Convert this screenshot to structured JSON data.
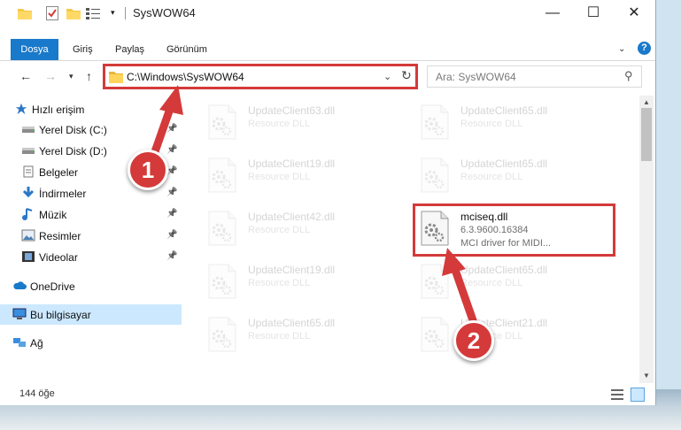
{
  "window": {
    "title": "SysWOW64",
    "controls": {
      "minimize": "—",
      "maximize": "☐",
      "close": "✕"
    }
  },
  "ribbon": {
    "tabs": [
      "Dosya",
      "Giriş",
      "Paylaş",
      "Görünüm"
    ],
    "help": "?"
  },
  "navbar": {
    "address": "C:\\Windows\\SysWOW64",
    "search_placeholder": "Ara: SysWOW64"
  },
  "sidebar": {
    "items": [
      {
        "label": "Hızlı erişim",
        "icon": "star-icon",
        "pinned": false
      },
      {
        "label": "Yerel Disk (C:)",
        "icon": "drive-icon",
        "pinned": true
      },
      {
        "label": "Yerel Disk (D:)",
        "icon": "drive-icon",
        "pinned": true
      },
      {
        "label": "Belgeler",
        "icon": "documents-icon",
        "pinned": true
      },
      {
        "label": "İndirmeler",
        "icon": "download-icon",
        "pinned": true
      },
      {
        "label": "Müzik",
        "icon": "music-icon",
        "pinned": true
      },
      {
        "label": "Resimler",
        "icon": "pictures-icon",
        "pinned": true
      },
      {
        "label": "Videolar",
        "icon": "video-icon",
        "pinned": true
      },
      {
        "label": "OneDrive",
        "icon": "cloud-icon",
        "pinned": false
      },
      {
        "label": "Bu bilgisayar",
        "icon": "computer-icon",
        "pinned": false,
        "selected": true
      },
      {
        "label": "Ağ",
        "icon": "network-icon",
        "pinned": false
      }
    ]
  },
  "files": [
    {
      "name": "UpdateClient63.dll",
      "desc": "Resource DLL",
      "faded": true
    },
    {
      "name": "UpdateClient65.dll",
      "desc": "Resource DLL",
      "faded": true
    },
    {
      "name": "UpdateClient19.dll",
      "desc": "Resource DLL",
      "faded": true
    },
    {
      "name": "UpdateClient65.dll",
      "desc": "Resource DLL",
      "faded": true
    },
    {
      "name": "UpdateClient42.dll",
      "desc": "Resource DLL",
      "faded": true
    },
    {
      "name": "mciseq.dll",
      "desc": "6.3.9600.16384",
      "desc2": "MCI driver for MIDI...",
      "faded": false
    },
    {
      "name": "UpdateClient19.dll",
      "desc": "Resource DLL",
      "faded": true
    },
    {
      "name": "UpdateClient65.dll",
      "desc": "Resource DLL",
      "faded": true
    },
    {
      "name": "UpdateClient65.dll",
      "desc": "Resource DLL",
      "faded": true
    },
    {
      "name": "UpdateClient21.dll",
      "desc": "Resource DLL",
      "faded": true
    }
  ],
  "status": {
    "item_count": "144 öğe"
  },
  "annotations": {
    "step1": "1",
    "step2": "2"
  },
  "colors": {
    "accent": "#1979ca",
    "annotation": "#d43a3a",
    "selected": "#cce8ff"
  }
}
